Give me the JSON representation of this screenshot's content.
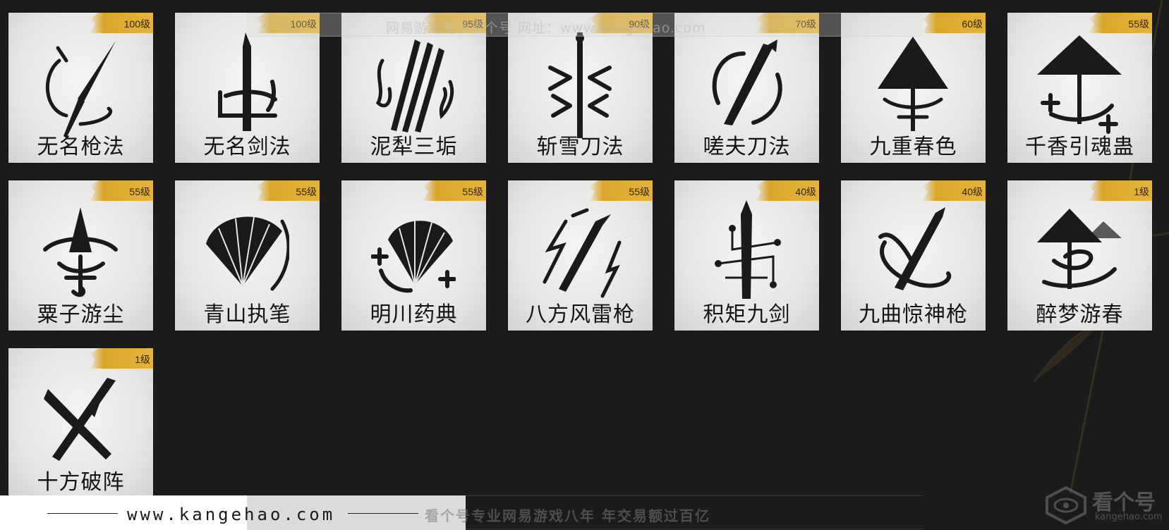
{
  "cards": [
    {
      "name": "无名枪法",
      "level": "100级",
      "icon": "spear-circle-icon"
    },
    {
      "name": "无名剑法",
      "level": "100级",
      "icon": "sword-upright-icon"
    },
    {
      "name": "泥犁三垢",
      "level": "95级",
      "icon": "triple-blade-flame-icon"
    },
    {
      "name": "斩雪刀法",
      "level": "90级",
      "icon": "snow-blade-icon"
    },
    {
      "name": "嗟夫刀法",
      "level": "70级",
      "icon": "blade-circle-icon"
    },
    {
      "name": "九重春色",
      "level": "60级",
      "icon": "umbrella-icon"
    },
    {
      "name": "千香引魂蛊",
      "level": "55级",
      "icon": "umbrella-plus-icon"
    },
    {
      "name": "粟子游尘",
      "level": "55级",
      "icon": "spinning-top-icon"
    },
    {
      "name": "青山执笔",
      "level": "55级",
      "icon": "fan-icon"
    },
    {
      "name": "明川药典",
      "level": "55级",
      "icon": "fan-plus-icon"
    },
    {
      "name": "八方风雷枪",
      "level": "55级",
      "icon": "lightning-spear-icon"
    },
    {
      "name": "积矩九剑",
      "level": "40级",
      "icon": "sword-constellation-icon"
    },
    {
      "name": "九曲惊神枪",
      "level": "40级",
      "icon": "spear-orbit-icon"
    },
    {
      "name": "醉梦游春",
      "level": "1级",
      "icon": "umbrella-swirl-icon"
    },
    {
      "name": "十方破阵",
      "level": "1级",
      "icon": "crossed-swords-icon"
    }
  ],
  "watermark": {
    "top_text": "网易游戏能读看个号   网址：www.kangehao.com",
    "url": "www.kangehao.com",
    "slogan": "看个号专业网易游戏八年   年交易额过百亿",
    "logo_text": "看个号",
    "logo_sub": "kangehao.com"
  },
  "colors": {
    "badge": "#e4b43a",
    "card": "#e9e9e7",
    "background": "#1b1b1b"
  }
}
